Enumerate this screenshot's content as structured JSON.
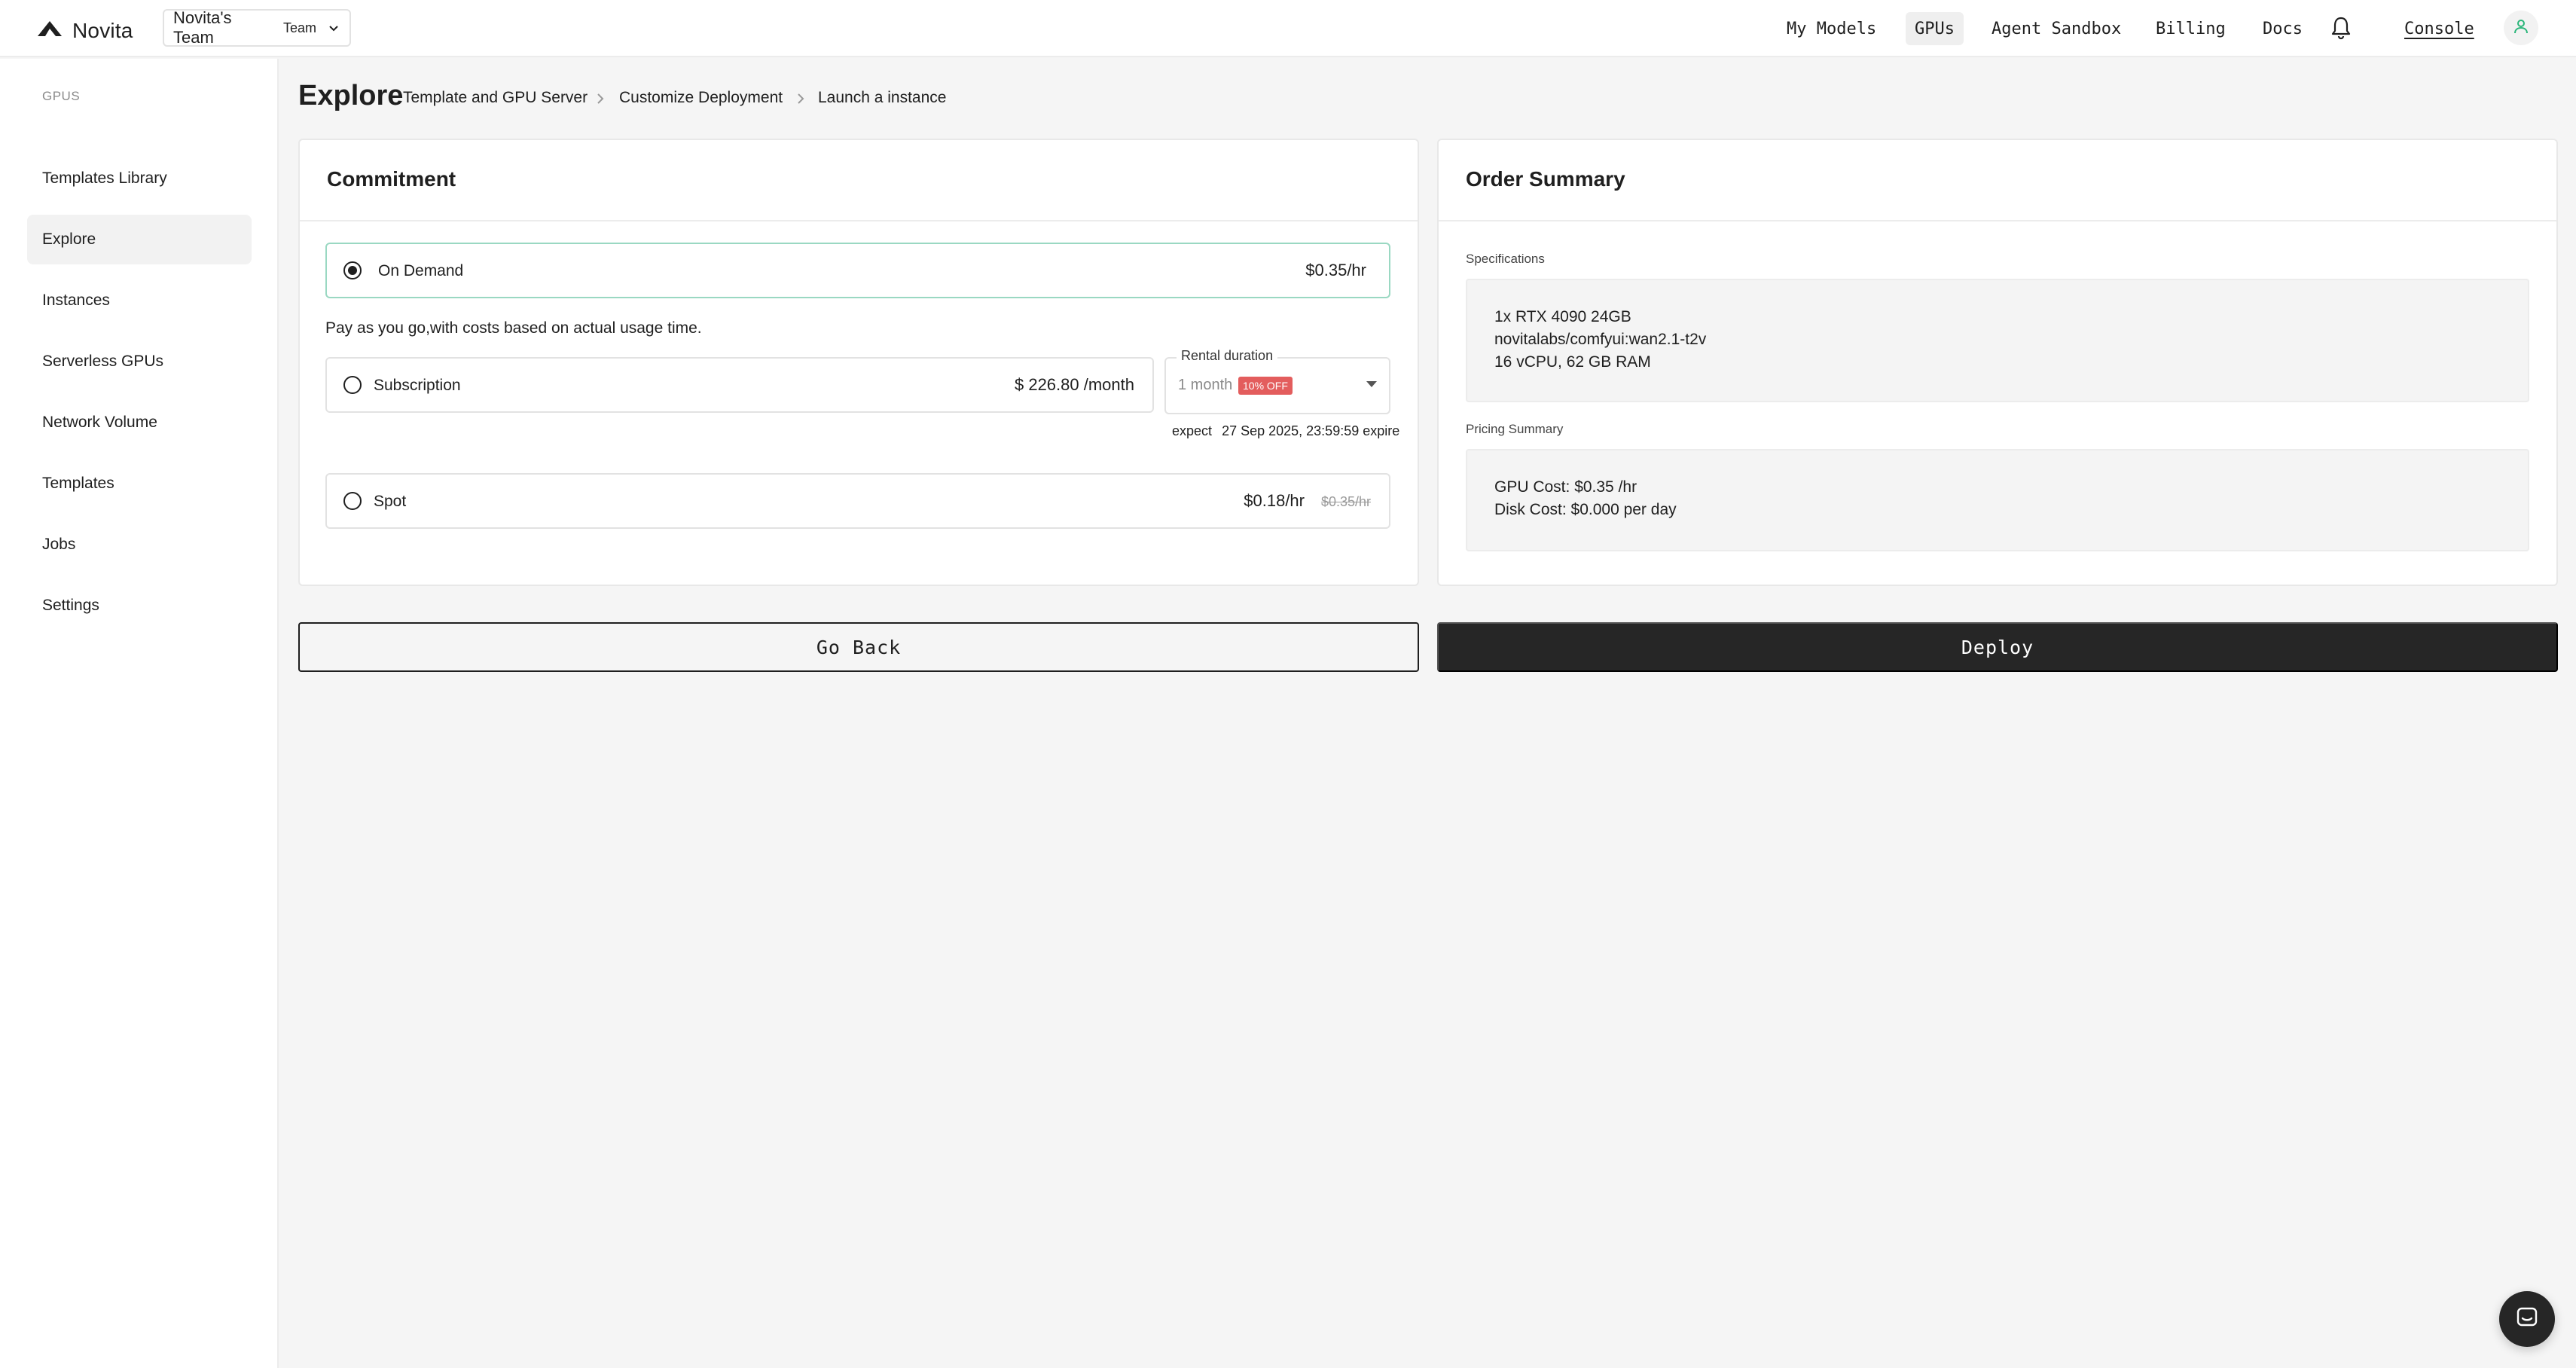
{
  "app": {
    "brand": "Novita"
  },
  "team": {
    "name": "Novita's Team",
    "tag": "Team"
  },
  "nav": {
    "items": [
      "My Models",
      "GPUs",
      "Agent Sandbox",
      "Billing",
      "Docs"
    ],
    "active": "GPUs",
    "console": "Console"
  },
  "sidebar": {
    "section": "GPUS",
    "items": [
      "Templates Library",
      "Explore",
      "Instances",
      "Serverless GPUs",
      "Network Volume",
      "Templates",
      "Jobs",
      "Settings"
    ],
    "active": "Explore"
  },
  "page": {
    "title": "Explore",
    "breadcrumb": [
      "Template and GPU Server",
      "Customize Deployment",
      "Launch a instance"
    ]
  },
  "commitment": {
    "title": "Commitment",
    "on_demand": {
      "label": "On Demand",
      "price": "$0.35/hr",
      "selected": true
    },
    "description": "Pay as you go,with costs based on actual usage time.",
    "subscription": {
      "label": "Subscription",
      "price": "$ 226.80 /month",
      "selected": false
    },
    "rental": {
      "label": "Rental duration",
      "value": "1 month",
      "badge": "10% OFF"
    },
    "expire": {
      "prefix": "expect",
      "date": "27 Sep 2025, 23:59:59 expire"
    },
    "spot": {
      "label": "Spot",
      "price": "$0.18/hr",
      "original_price": "$0.35/hr",
      "selected": false
    }
  },
  "order_summary": {
    "title": "Order Summary",
    "specs_label": "Specifications",
    "specs": [
      "1x RTX 4090 24GB",
      "novitalabs/comfyui:wan2.1-t2v",
      "16 vCPU, 62 GB RAM"
    ],
    "pricing_label": "Pricing Summary",
    "pricing": [
      "GPU Cost: $0.35 /hr",
      "Disk Cost: $0.000 per day"
    ]
  },
  "actions": {
    "back": "Go Back",
    "deploy": "Deploy"
  },
  "colors": {
    "accent_border": "#9ad8c2",
    "discount_badge": "#e35d5d",
    "primary_button": "#262626",
    "avatar_icon": "#2bb67a"
  },
  "icons": [
    "novita-logo-icon",
    "chevron-down-icon",
    "bell-icon",
    "user-icon",
    "chevron-right-icon",
    "caret-down-icon",
    "chat-icon"
  ]
}
